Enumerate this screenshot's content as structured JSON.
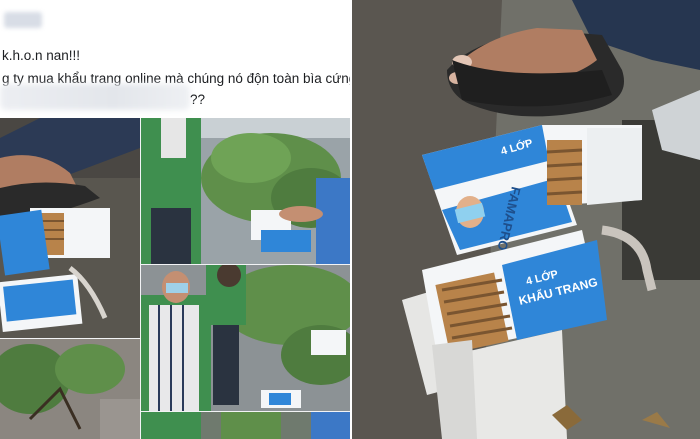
{
  "post": {
    "line1": "k.h.o.n nan!!!",
    "line2": "g ty mua khẩu trang online mà chúng nó độn toàn bìa cứng ở",
    "line3": "??"
  },
  "box_text": {
    "brand": "FAMAPRO",
    "product": "KHẨU TRANG",
    "layers": "4 LỚP"
  },
  "colors": {
    "box_blue": "#2f86d8",
    "box_white": "#f4f6f8",
    "pavement": "#6b6660",
    "vest_green": "#3f8f4f",
    "cardboard": "#b8834a"
  }
}
